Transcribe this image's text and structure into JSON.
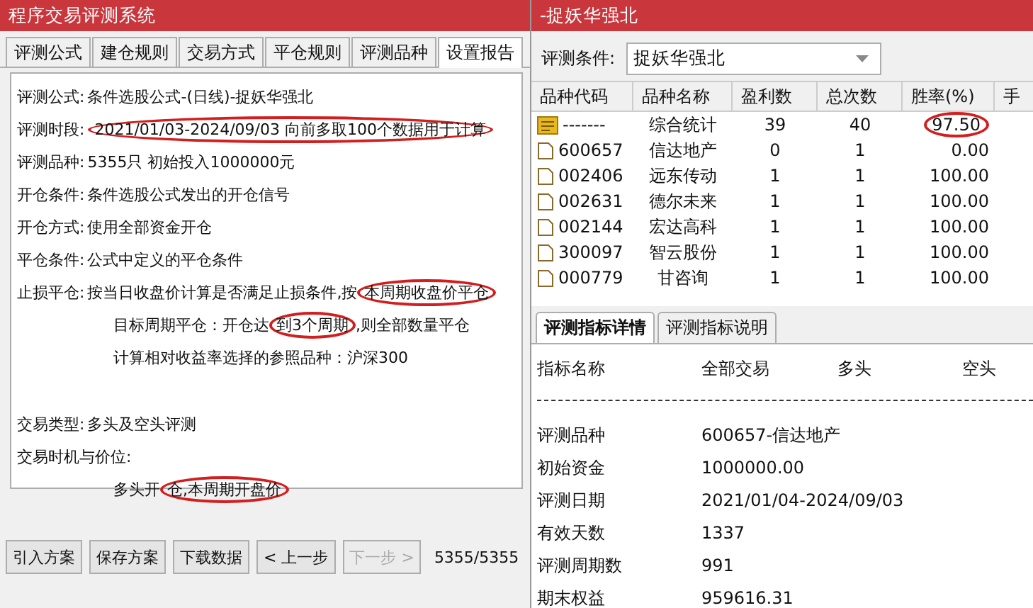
{
  "left_window": {
    "title": "程序交易评测系统",
    "tabs": [
      {
        "label": "评测公式",
        "selected": false
      },
      {
        "label": "建仓规则",
        "selected": false
      },
      {
        "label": "交易方式",
        "selected": false
      },
      {
        "label": "平仓规则",
        "selected": false
      },
      {
        "label": "评测品种",
        "selected": false
      },
      {
        "label": "设置报告",
        "selected": true
      }
    ],
    "report_lines": [
      {
        "kind": "field",
        "label": "评测公式:",
        "segments": [
          {
            "text": "条件选股公式-(日线)-捉妖华强北",
            "circled": false
          }
        ]
      },
      {
        "kind": "field",
        "label": "评测时段:",
        "segments": [
          {
            "text": "2021/01/03-2024/09/03 向前多取100个数据用于计算",
            "circled": true
          }
        ]
      },
      {
        "kind": "field",
        "label": "评测品种:",
        "segments": [
          {
            "text": "5355只 初始投入1000000元",
            "circled": false
          }
        ]
      },
      {
        "kind": "field",
        "label": "开仓条件:",
        "segments": [
          {
            "text": "条件选股公式发出的开仓信号",
            "circled": false
          }
        ]
      },
      {
        "kind": "field",
        "label": "开仓方式:",
        "segments": [
          {
            "text": "使用全部资金开仓",
            "circled": false
          }
        ]
      },
      {
        "kind": "field",
        "label": "平仓条件:",
        "segments": [
          {
            "text": "公式中定义的平仓条件",
            "circled": false
          }
        ]
      },
      {
        "kind": "field",
        "label": "止损平仓:",
        "segments": [
          {
            "text": "按当日收盘价计算是否满足止损条件,按",
            "circled": false
          },
          {
            "text": "本周期收盘价平仓",
            "circled": true
          }
        ]
      },
      {
        "kind": "sub",
        "segments": [
          {
            "text": "目标周期平仓：开仓达",
            "circled": false
          },
          {
            "text": "到3个周期",
            "circled": true
          },
          {
            "text": ",则全部数量平仓",
            "circled": false
          }
        ]
      },
      {
        "kind": "sub",
        "segments": [
          {
            "text": "计算相对收益率选择的参照品种：沪深300",
            "circled": false
          }
        ]
      },
      {
        "kind": "gap"
      },
      {
        "kind": "field",
        "label": "交易类型:",
        "segments": [
          {
            "text": "多头及空头评测",
            "circled": false
          }
        ]
      },
      {
        "kind": "field",
        "label": "交易时机与价位:"
      },
      {
        "kind": "sub",
        "segments": [
          {
            "text": "多头开",
            "circled": false
          },
          {
            "text": "仓,本周期开盘价",
            "circled": true
          }
        ]
      }
    ],
    "buttons": [
      {
        "label": "引入方案",
        "disabled": false
      },
      {
        "label": "保存方案",
        "disabled": false
      },
      {
        "label": "下载数据",
        "disabled": false
      },
      {
        "label": "< 上一步",
        "disabled": false
      },
      {
        "label": "下一步 >",
        "disabled": true
      }
    ],
    "progress_count": "5355/5355"
  },
  "right_window": {
    "title": "-捉妖华强北",
    "condition_label": "评测条件:",
    "condition_value": "捉妖华强北",
    "table": {
      "columns": [
        "品种代码",
        "品种名称",
        "盈利数",
        "总次数",
        "胜率(%)",
        "手"
      ],
      "rows": [
        {
          "kind": "summary",
          "cells": [
            "-------",
            "综合统计",
            "39",
            "40",
            "97.50"
          ],
          "circled": true
        },
        {
          "kind": "stock",
          "cells": [
            "600657",
            "信达地产",
            "0",
            "1",
            "0.00"
          ],
          "circled": false
        },
        {
          "kind": "stock",
          "cells": [
            "002406",
            "远东传动",
            "1",
            "1",
            "100.00"
          ],
          "circled": false
        },
        {
          "kind": "stock",
          "cells": [
            "002631",
            "德尔未来",
            "1",
            "1",
            "100.00"
          ],
          "circled": false
        },
        {
          "kind": "stock",
          "cells": [
            "002144",
            "宏达高科",
            "1",
            "1",
            "100.00"
          ],
          "circled": false
        },
        {
          "kind": "stock",
          "cells": [
            "300097",
            "智云股份",
            "1",
            "1",
            "100.00"
          ],
          "circled": false
        },
        {
          "kind": "stock",
          "cells": [
            "000779",
            "甘咨询",
            "1",
            "1",
            "100.00"
          ],
          "circled": false
        }
      ]
    },
    "tabs": [
      {
        "label": "评测指标详情",
        "selected": true
      },
      {
        "label": "评测指标说明",
        "selected": false
      }
    ],
    "details": {
      "columns": [
        "指标名称",
        "全部交易",
        "多头",
        "空头"
      ],
      "rows": [
        [
          "评测品种",
          "600657-信达地产"
        ],
        [
          "初始资金",
          "1000000.00"
        ],
        [
          "评测日期",
          "2021/01/04-2024/09/03"
        ],
        [
          "有效天数",
          "1337"
        ],
        [
          "评测周期数",
          " 991"
        ],
        [
          "期末权益",
          "959616.31"
        ]
      ]
    }
  }
}
